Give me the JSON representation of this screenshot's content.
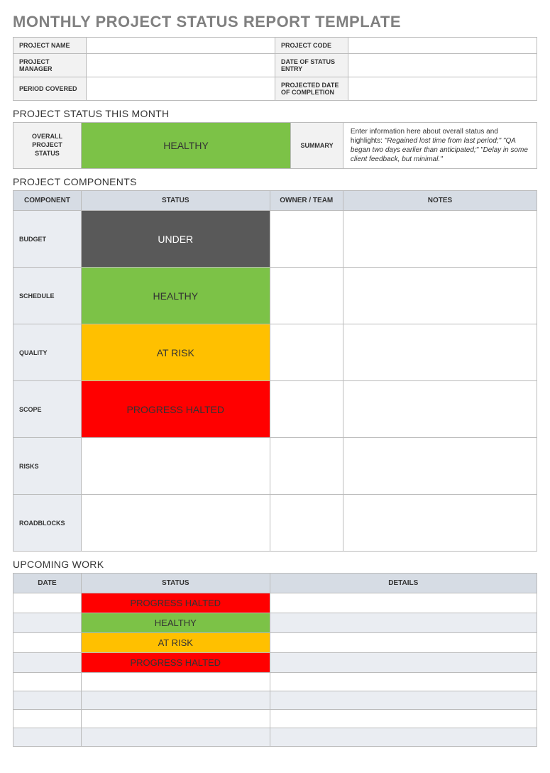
{
  "title": "MONTHLY PROJECT STATUS REPORT TEMPLATE",
  "meta": {
    "rows": [
      {
        "label1": "PROJECT NAME",
        "val1": "",
        "label2": "PROJECT CODE",
        "val2": ""
      },
      {
        "label1": "PROJECT MANAGER",
        "val1": "",
        "label2": "DATE OF STATUS ENTRY",
        "val2": ""
      },
      {
        "label1": "PERIOD COVERED",
        "val1": "",
        "label2": "PROJECTED DATE OF COMPLETION",
        "val2": ""
      }
    ]
  },
  "status_month": {
    "heading": "PROJECT STATUS THIS MONTH",
    "overall_label": "OVERALL PROJECT STATUS",
    "overall_status": "HEALTHY",
    "overall_class": "bg-healthy",
    "summary_label": "SUMMARY",
    "summary_pre": "Enter information here about overall status and highlights: ",
    "summary_italic": "\"Regained lost time from last period;\" \"QA began two days earlier than anticipated;\" \"Delay in some client feedback, but minimal.\""
  },
  "components": {
    "heading": "PROJECT COMPONENTS",
    "headers": {
      "component": "COMPONENT",
      "status": "STATUS",
      "owner": "OWNER / TEAM",
      "notes": "NOTES"
    },
    "rows": [
      {
        "label": "BUDGET",
        "status": "UNDER",
        "class": "bg-under",
        "owner": "",
        "notes": ""
      },
      {
        "label": "SCHEDULE",
        "status": "HEALTHY",
        "class": "bg-healthy",
        "owner": "",
        "notes": ""
      },
      {
        "label": "QUALITY",
        "status": "AT RISK",
        "class": "bg-risk",
        "owner": "",
        "notes": ""
      },
      {
        "label": "SCOPE",
        "status": "PROGRESS HALTED",
        "class": "bg-halted",
        "owner": "",
        "notes": ""
      },
      {
        "label": "RISKS",
        "status": "",
        "class": "bg-none",
        "owner": "",
        "notes": ""
      },
      {
        "label": "ROADBLOCKS",
        "status": "",
        "class": "bg-none",
        "owner": "",
        "notes": ""
      }
    ]
  },
  "upcoming": {
    "heading": "UPCOMING WORK",
    "headers": {
      "date": "DATE",
      "status": "STATUS",
      "details": "DETAILS"
    },
    "rows": [
      {
        "date": "",
        "status": "PROGRESS HALTED",
        "class": "bg-halted",
        "details": "",
        "alt": false
      },
      {
        "date": "",
        "status": "HEALTHY",
        "class": "bg-healthy",
        "details": "",
        "alt": true
      },
      {
        "date": "",
        "status": "AT RISK",
        "class": "bg-risk",
        "details": "",
        "alt": false
      },
      {
        "date": "",
        "status": "PROGRESS HALTED",
        "class": "bg-halted",
        "details": "",
        "alt": true
      },
      {
        "date": "",
        "status": "",
        "class": "bg-none",
        "details": "",
        "alt": false
      },
      {
        "date": "",
        "status": "",
        "class": "bg-none-alt",
        "details": "",
        "alt": true
      },
      {
        "date": "",
        "status": "",
        "class": "bg-none",
        "details": "",
        "alt": false
      },
      {
        "date": "",
        "status": "",
        "class": "bg-none-alt",
        "details": "",
        "alt": true
      }
    ]
  }
}
